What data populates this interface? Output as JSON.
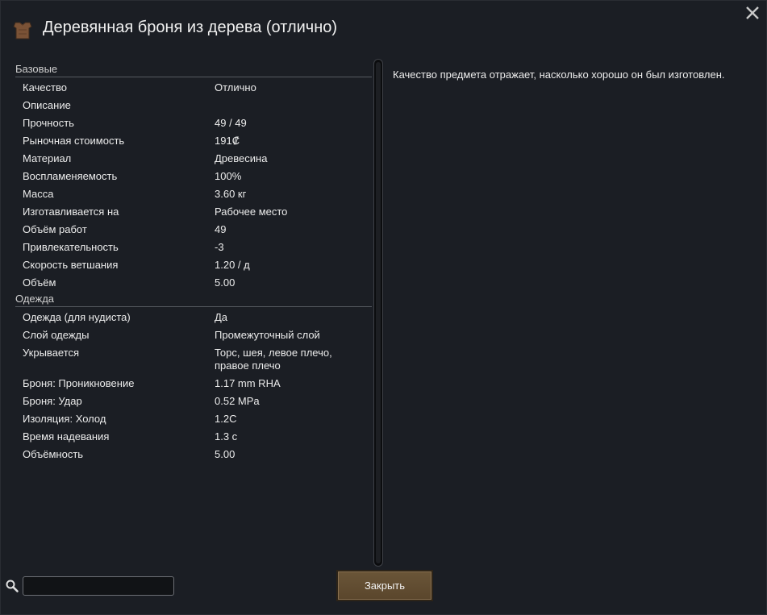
{
  "dialog": {
    "title": "Деревянная броня из дерева (отлично)",
    "title_icon": "armor-icon",
    "close_icon": "close-icon"
  },
  "categories": [
    {
      "name": "Базовые",
      "rows": [
        {
          "label": "Качество",
          "value": "Отлично"
        },
        {
          "label": "Описание",
          "value": ""
        },
        {
          "label": "Прочность",
          "value": "49 / 49"
        },
        {
          "label": "Рыночная стоимость",
          "value": "191₡"
        },
        {
          "label": "Материал",
          "value": "Древесина"
        },
        {
          "label": "Воспламеняемость",
          "value": "100%"
        },
        {
          "label": "Масса",
          "value": "3.60 кг"
        },
        {
          "label": "Изготавливается на",
          "value": "Рабочее место"
        },
        {
          "label": "Объём работ",
          "value": "49"
        },
        {
          "label": "Привлекательность",
          "value": "-3"
        },
        {
          "label": "Скорость ветшания",
          "value": "1.20 / д"
        },
        {
          "label": "Объём",
          "value": "5.00"
        }
      ]
    },
    {
      "name": "Одежда",
      "rows": [
        {
          "label": "Одежда (для нудиста)",
          "value": "Да"
        },
        {
          "label": "Слой одежды",
          "value": "Промежуточный слой"
        },
        {
          "label": "Укрывается",
          "value": "Торс, шея, левое плечо, правое плечо"
        },
        {
          "label": "Броня: Проникновение",
          "value": "1.17 mm RHA"
        },
        {
          "label": "Броня: Удар",
          "value": "0.52 MPa"
        },
        {
          "label": "Изоляция: Холод",
          "value": "1.2C"
        },
        {
          "label": "Время надевания",
          "value": "1.3 с"
        },
        {
          "label": "Объёмность",
          "value": "5.00"
        }
      ]
    }
  ],
  "description": "Качество предмета отражает, насколько хорошо он был изготовлен.",
  "search": {
    "value": "",
    "icon": "search-icon"
  },
  "footer": {
    "close_label": "Закрыть"
  },
  "colors": {
    "background": "#1b1e24",
    "button": "#5f4b30",
    "divider": "#565a61"
  }
}
